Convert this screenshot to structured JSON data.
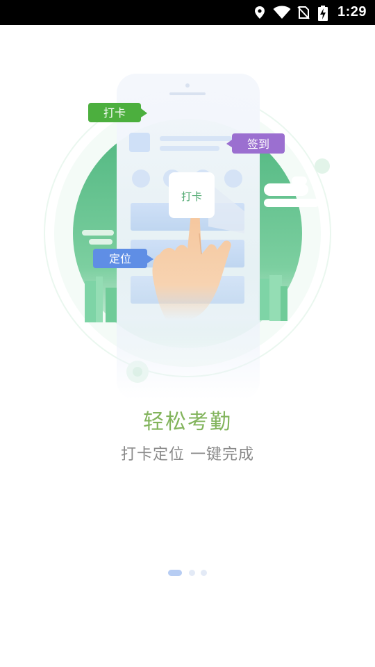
{
  "status_bar": {
    "time": "1:29",
    "icons": [
      "location-icon",
      "wifi-icon",
      "no-sim-icon",
      "battery-charging-icon"
    ]
  },
  "illustration": {
    "bubble_punch": "打卡",
    "bubble_sign": "签到",
    "bubble_locate": "定位",
    "card_punch": "打卡",
    "colors": {
      "circle": "#5ebf8a",
      "phone": "#f3f6fb",
      "bubble_punch": "#4caf3e",
      "bubble_sign": "#9b6fd0",
      "bubble_locate": "#5f8ee5"
    }
  },
  "onboarding": {
    "title": "轻松考勤",
    "subtitle": "打卡定位 一键完成",
    "page_count": 3,
    "current_page": 1
  }
}
